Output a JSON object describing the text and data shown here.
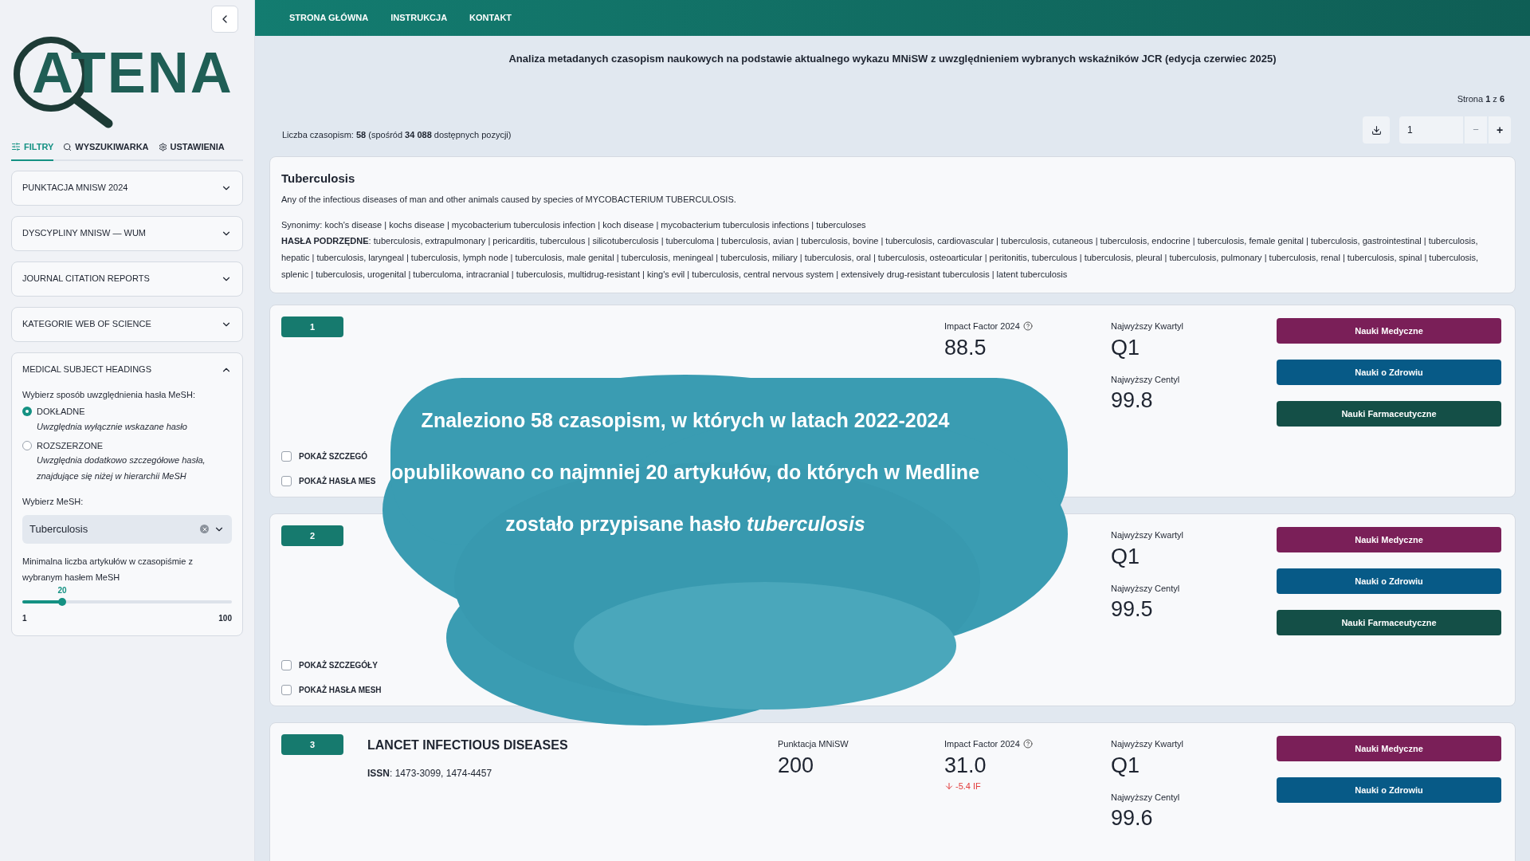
{
  "sidebar": {
    "logo": "ATENA",
    "tabs": [
      {
        "label": "FILTRY",
        "selected": true
      },
      {
        "label": "WYSZUKIWARKA",
        "selected": false
      },
      {
        "label": "USTAWIENIA",
        "selected": false
      }
    ],
    "sections": [
      {
        "title": "PUNKTACJA MNISW 2024",
        "expanded": false
      },
      {
        "title": "DYSCYPLINY MNISW — WUM",
        "expanded": false
      },
      {
        "title": "JOURNAL CITATION REPORTS",
        "expanded": false
      },
      {
        "title": "KATEGORIE WEB OF SCIENCE",
        "expanded": false
      },
      {
        "title": "MEDICAL SUBJECT HEADINGS",
        "expanded": true
      }
    ],
    "mesh": {
      "mode_label": "Wybierz sposób uwzględnienia hasła MeSH:",
      "options": [
        {
          "label": "DOKŁADNE",
          "hint": "Uwzględnia wyłącznie wskazane hasło",
          "selected": true
        },
        {
          "label": "ROZSZERZONE",
          "hint": "Uwzględnia dodatkowo szczegółowe hasła, znajdujące się niżej w hierarchii MeSH",
          "selected": false
        }
      ],
      "select_label": "Wybierz MeSH:",
      "select_value": "Tuberculosis",
      "slider_label": "Minimalna liczba artykułów w czasopiśmie z wybranym hasłem MeSH",
      "slider": {
        "value": "20",
        "min": "1",
        "max": "100",
        "level": 0.19
      }
    }
  },
  "nav": [
    "STRONA GŁÓWNA",
    "INSTRUKCJA",
    "KONTAKT"
  ],
  "heading": "Analiza metadanych czasopism naukowych na podstawie aktualnego wykazu MNiSW z uwzględnieniem wybranych wskaźników JCR (edycja czerwiec 2025)",
  "page_info": "Strona **1** z **6**",
  "count": "Liczba czasopism: **58** (spośród **34 088** dostępnych pozycji)",
  "pager": {
    "value": "1",
    "minus": "−",
    "plus": "+",
    "minus_disabled": true
  },
  "term": {
    "title": "Tuberculosis",
    "description": "Any of the infectious diseases of man and other animals caused by species of MYCOBACTERIUM TUBERCULOSIS.",
    "synonyms": "Synonimy: koch's disease | kochs disease | mycobacterium tuberculosis infection | koch disease | mycobacterium tuberculosis infections | tuberculoses",
    "narrower": "**HASŁA PODRZĘDNE**: tuberculosis, extrapulmonary | pericarditis, tuberculous | silicotuberculosis | tuberculoma | tuberculosis, avian | tuberculosis, bovine | tuberculosis, cardiovascular | tuberculosis, cutaneous | tuberculosis, endocrine | tuberculosis, female genital | tuberculosis, gastrointestinal | tuberculosis, hepatic | tuberculosis, laryngeal | tuberculosis, lymph node | tuberculosis, male genital | tuberculosis, meningeal | tuberculosis, miliary | tuberculosis, oral | tuberculosis, osteoarticular | peritonitis, tuberculous | tuberculosis, pleural | tuberculosis, pulmonary | tuberculosis, renal | tuberculosis, spinal | tuberculosis, splenic | tuberculosis, urogenital | tuberculoma, intracranial | tuberculosis, multidrug-resistant | king's evil | tuberculosis, central nervous system | extensively drug-resistant tuberculosis | latent tuberculosis"
  },
  "journals": [
    {
      "index": "1",
      "impact_label": "Impact Factor 2024",
      "impact": "88.5",
      "quartile_label": "Najwyższy Kwartyl",
      "quartile": "Q1",
      "centile_label": "Najwyższy Centyl",
      "centile": "99.8",
      "disciplines": [
        {
          "label": "Nauki Medyczne",
          "color": "#7a1f58"
        },
        {
          "label": "Nauki o Zdrowiu",
          "color": "#075a87"
        },
        {
          "label": "Nauki Farmaceutyczne",
          "color": "#144f47"
        }
      ],
      "toggles": [
        {
          "label": "POKAŻ SZCZEGÓ",
          "checked": false
        },
        {
          "label": "POKAŻ HASŁA MES",
          "checked": false
        }
      ]
    },
    {
      "index": "2",
      "quartile_label": "Najwyższy Kwartyl",
      "quartile": "Q1",
      "centile_label": "Najwyższy Centyl",
      "centile": "99.5",
      "disciplines": [
        {
          "label": "Nauki Medyczne",
          "color": "#7a1f58"
        },
        {
          "label": "Nauki o Zdrowiu",
          "color": "#075a87"
        },
        {
          "label": "Nauki Farmaceutyczne",
          "color": "#144f47"
        }
      ],
      "toggles": [
        {
          "label": "POKAŻ SZCZEGÓŁY",
          "checked": false
        },
        {
          "label": "POKAŻ HASŁA MESH",
          "checked": false
        }
      ]
    },
    {
      "index": "3",
      "title": "LANCET INFECTIOUS DISEASES",
      "issn": "**ISSN**: 1473-3099, 1474-4457",
      "points_label": "Punktacja MNiSW",
      "points": "200",
      "impact_label": "Impact Factor 2024",
      "impact": "31.0",
      "impact_change": "-5.4 IF",
      "quartile_label": "Najwyższy Kwartyl",
      "quartile": "Q1",
      "centile_label": "Najwyższy Centyl",
      "centile": "99.6",
      "disciplines": [
        {
          "label": "Nauki Medyczne",
          "color": "#7a1f58"
        },
        {
          "label": "Nauki o Zdrowiu",
          "color": "#075a87"
        }
      ]
    }
  ],
  "overlay": {
    "lines": [
      "Znaleziono 58 czasopism, w których w latach 2022-2024",
      "opublikowano co najmniej 20 artykułów, do których w Medline",
      "zostało przypisane hasło *tuberculosis*"
    ]
  }
}
